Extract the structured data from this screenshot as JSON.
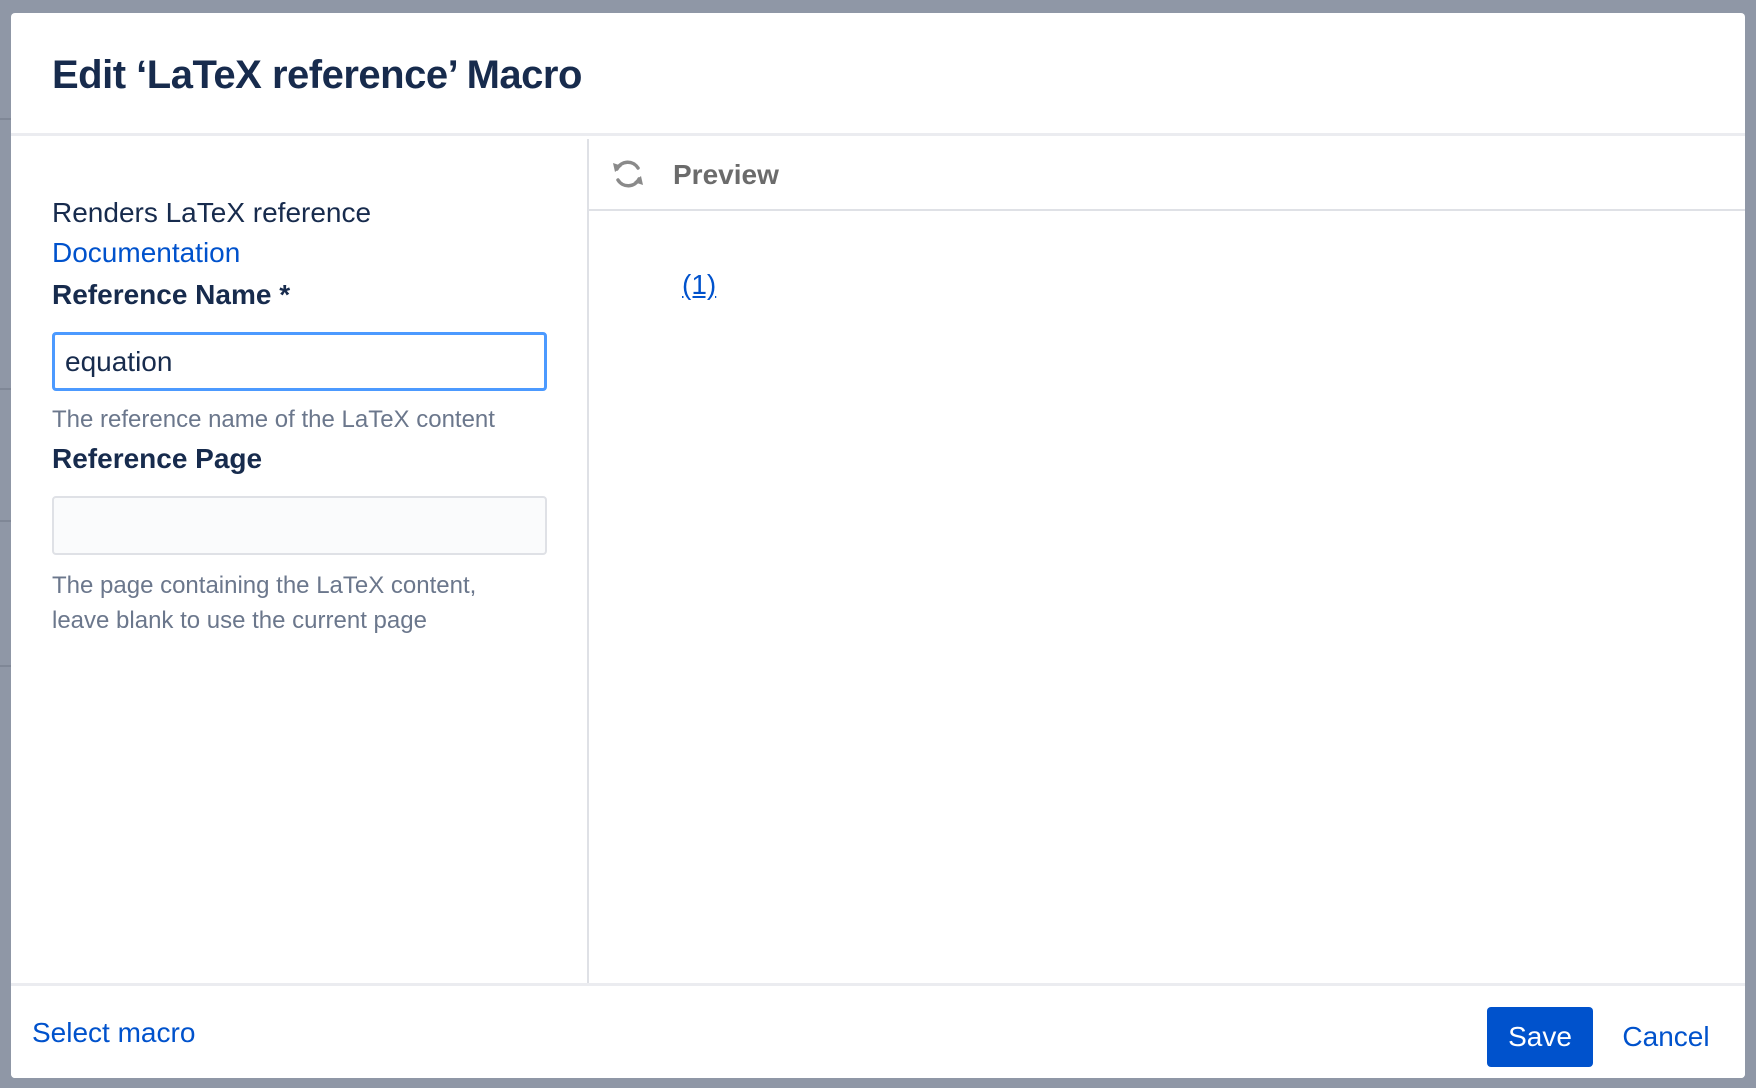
{
  "dialog": {
    "title": "Edit ‘LaTeX reference’ Macro"
  },
  "left_panel": {
    "description": "Renders LaTeX reference",
    "documentation_link": "Documentation",
    "reference_name": {
      "label": "Reference Name *",
      "value": "equation",
      "hint": "The reference name of the LaTeX content"
    },
    "reference_page": {
      "label": "Reference Page",
      "value": "",
      "hint_line1": "The page containing the LaTeX content,",
      "hint_line2": "leave blank to use the current page"
    }
  },
  "preview": {
    "icon": "refresh-icon",
    "label": "Preview",
    "rendered_reference": "(1)"
  },
  "footer": {
    "select_macro": "Select macro",
    "save_label": "Save",
    "cancel_label": "Cancel"
  },
  "colors": {
    "accent": "#0052cc",
    "title": "#172b4d",
    "focus_ring": "#4c9aff",
    "overlay": "#8f97a6"
  }
}
